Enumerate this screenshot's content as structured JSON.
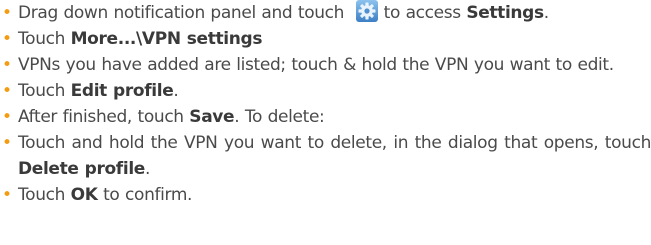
{
  "colors": {
    "bullet": "#f39c12",
    "text": "#4a4a4a",
    "settings_icon_bg": "#5b9bd5"
  },
  "bullet_char": "•",
  "items": [
    {
      "pre": "Drag down notification panel and touch",
      "icon": "settings-gear-icon",
      "mid": "to access",
      "bold": "Settings",
      "post": "."
    },
    {
      "pre": "Touch",
      "bold": "More...\\VPN settings",
      "post": ""
    },
    {
      "pre": "VPNs you have added are listed; touch & hold the VPN you want to edit."
    },
    {
      "pre": "Touch",
      "bold": "Edit profile",
      "post": "."
    },
    {
      "pre": "After finished, touch",
      "bold": "Save",
      "post": ". To delete:"
    },
    {
      "pre": "Touch and hold the VPN you want to delete, in the dialog that opens, touch",
      "bold": "Delete profile",
      "post": "."
    },
    {
      "pre": "Touch",
      "bold": "OK",
      "post": "to confirm."
    }
  ]
}
